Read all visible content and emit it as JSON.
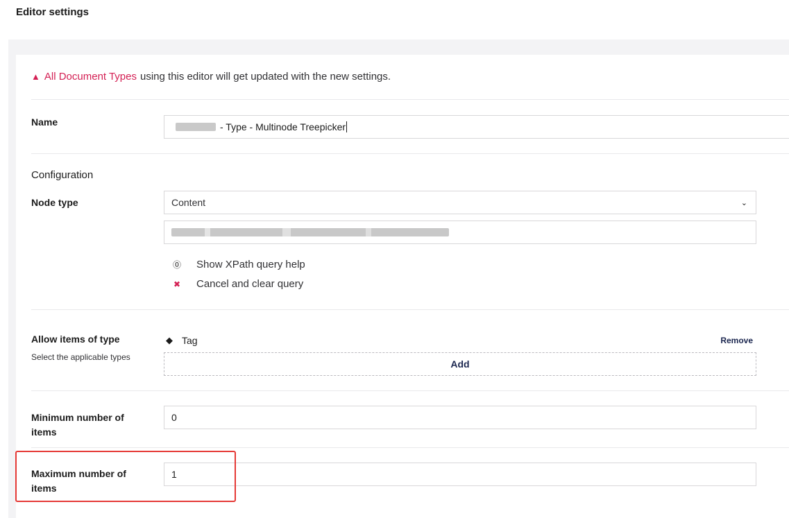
{
  "header": {
    "title": "Editor settings"
  },
  "notice": {
    "link_text": "All Document Types",
    "rest_text": "using this editor will get updated with the new settings."
  },
  "name_field": {
    "label": "Name",
    "value": "- Type - Multinode Treepicker"
  },
  "configuration": {
    "heading": "Configuration",
    "node_type": {
      "label": "Node type",
      "selected": "Content"
    },
    "actions": [
      {
        "icon": "help-circle-icon",
        "label": "Show XPath query help"
      },
      {
        "icon": "close-icon",
        "label": "Cancel and clear query"
      }
    ]
  },
  "allow_items": {
    "label": "Allow items of type",
    "description": "Select the applicable types",
    "items": [
      {
        "icon": "tag-icon",
        "name": "Tag",
        "remove_label": "Remove"
      }
    ],
    "add_label": "Add"
  },
  "min_items": {
    "label_line1": "Minimum number of",
    "label_line2": "items",
    "value": "0"
  },
  "max_items": {
    "label_line1": "Maximum number of",
    "label_line2": "items",
    "value": "1"
  },
  "colors": {
    "accent": "#d42054",
    "text_dark": "#1b264f",
    "highlight": "#e53935"
  }
}
